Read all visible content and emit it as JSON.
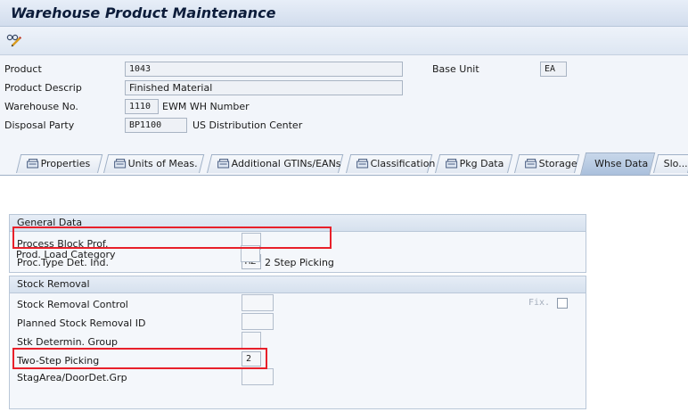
{
  "window": {
    "title": "Warehouse Product Maintenance"
  },
  "toolbar": {
    "tool_icon": "glasses-pencil-icon"
  },
  "header": {
    "product": {
      "label": "Product",
      "value": "1043"
    },
    "product_descrip": {
      "label": "Product Descrip",
      "value": "Finished Material"
    },
    "warehouse": {
      "label": "Warehouse No.",
      "value": "1110",
      "text": "EWM WH Number"
    },
    "disposal_party": {
      "label": "Disposal Party",
      "value": "BP1100",
      "text": "US Distribution Center"
    },
    "base_unit": {
      "label": "Base Unit",
      "value": "EA"
    }
  },
  "tabs": [
    {
      "label": "Properties",
      "icon": "doc-stack-icon"
    },
    {
      "label": "Units of Meas.",
      "icon": "doc-stack-icon"
    },
    {
      "label": "Additional GTINs/EANs",
      "icon": "doc-stack-icon"
    },
    {
      "label": "Classification",
      "icon": "doc-stack-icon"
    },
    {
      "label": "Pkg Data",
      "icon": "doc-stack-icon"
    },
    {
      "label": "Storage",
      "icon": "doc-stack-icon"
    },
    {
      "label": "Whse Data",
      "active": true
    },
    {
      "label": "Slo..."
    }
  ],
  "general_data": {
    "title": "General Data",
    "process_block_prof": {
      "label": "Process Block Prof.",
      "value": ""
    },
    "proc_type_det_ind": {
      "label": "Proc.Type Det. Ind.",
      "value": "MZ",
      "text": "2 Step Picking"
    },
    "prod_load_category": {
      "label": "Prod. Load Category",
      "value": ""
    }
  },
  "stock_removal": {
    "title": "Stock Removal",
    "stock_removal_control": {
      "label": "Stock Removal Control",
      "value": ""
    },
    "fix_label": "Fix.",
    "planned_stock_removal_id": {
      "label": "Planned Stock Removal ID",
      "value": ""
    },
    "stk_determin_group": {
      "label": "Stk Determin. Group",
      "value": ""
    },
    "two_step_picking": {
      "label": "Two-Step Picking",
      "value": "2"
    },
    "stag_area": {
      "label": "StagArea/DoorDet.Grp",
      "value": ""
    }
  },
  "colors": {
    "highlight": "#e8202a",
    "title_text": "#0c1c3a",
    "active_tab": "#aac0dc"
  }
}
